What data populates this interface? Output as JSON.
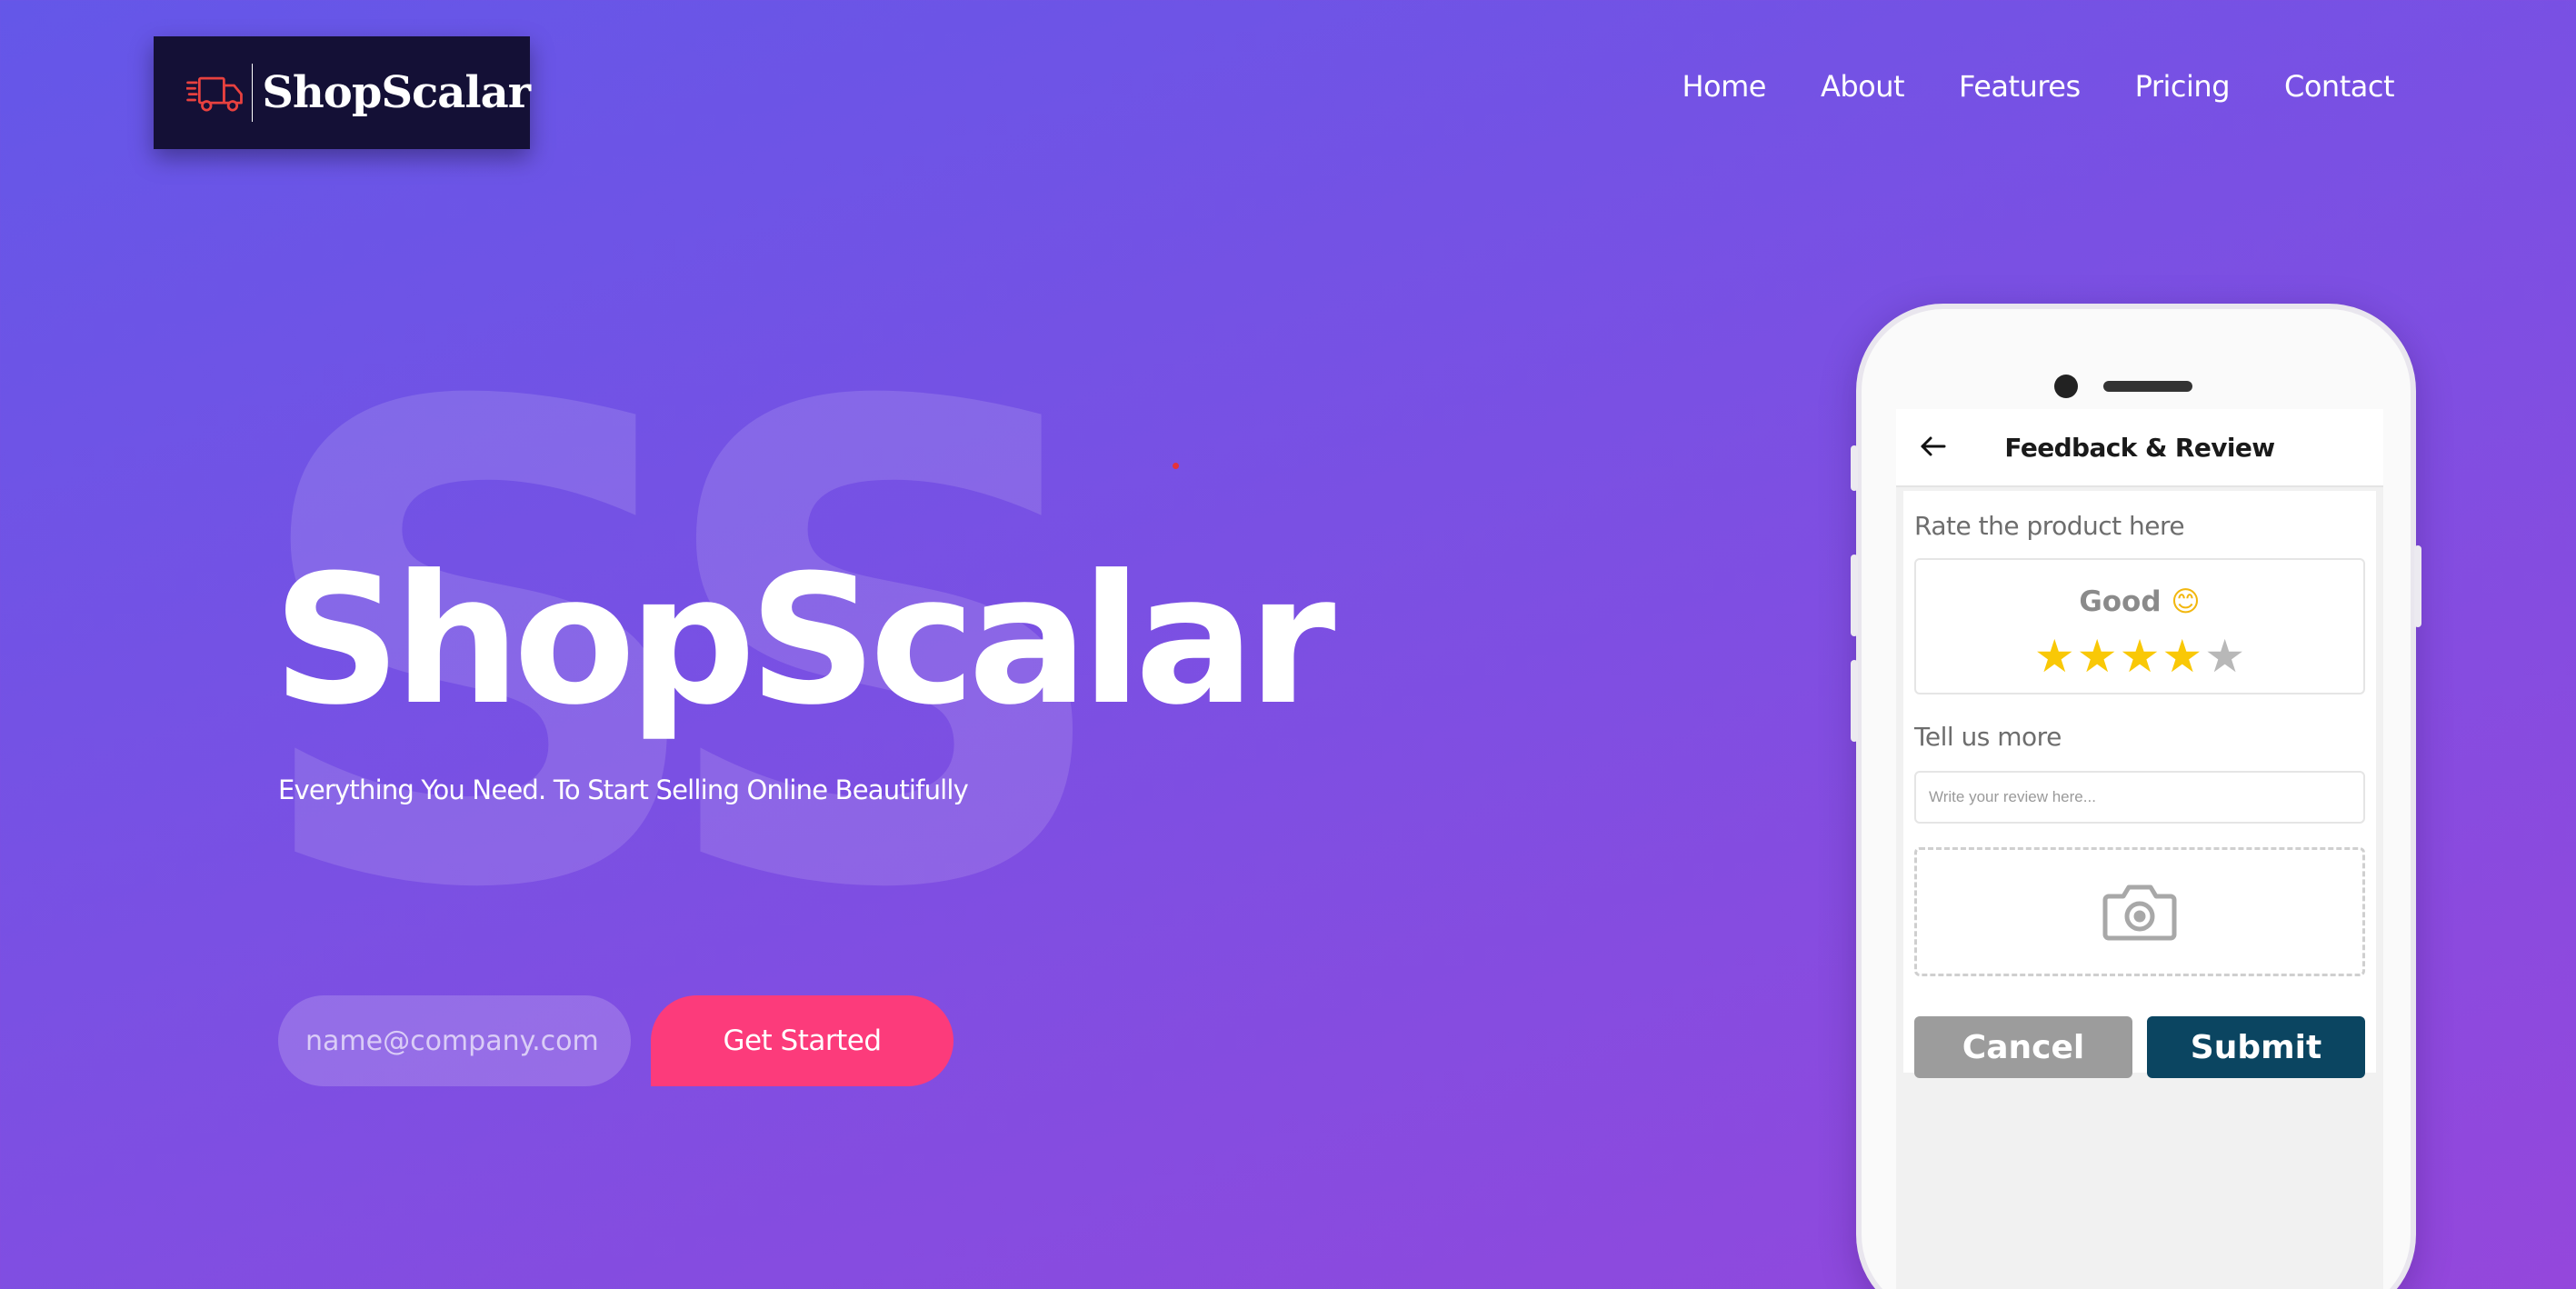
{
  "brand": {
    "name": "ShopScalar"
  },
  "nav": {
    "items": [
      {
        "label": "Home"
      },
      {
        "label": "About"
      },
      {
        "label": "Features"
      },
      {
        "label": "Pricing"
      },
      {
        "label": "Contact"
      }
    ]
  },
  "hero": {
    "watermark": "SS",
    "title": "ShopScalar",
    "subtitle": "Everything You Need. To Start Selling Online Beautifully",
    "email_placeholder": "name@company.com",
    "cta_label": "Get Started"
  },
  "phone": {
    "app_title": "Feedback & Review",
    "rate_label": "Rate the product here",
    "rating_text": "Good",
    "rating_emoji": "😊",
    "rating_value": 4,
    "rating_max": 5,
    "more_label": "Tell us more",
    "review_placeholder": "Write your review here...",
    "cancel_label": "Cancel",
    "submit_label": "Submit"
  },
  "colors": {
    "cta": "#fc3b7b",
    "submit": "#0b4561",
    "cancel": "#9c9c9c",
    "star_filled": "#f9c806",
    "logo_bg": "#141036"
  },
  "icons": [
    "delivery-truck-icon",
    "back-arrow-icon",
    "star-icon",
    "camera-icon"
  ]
}
